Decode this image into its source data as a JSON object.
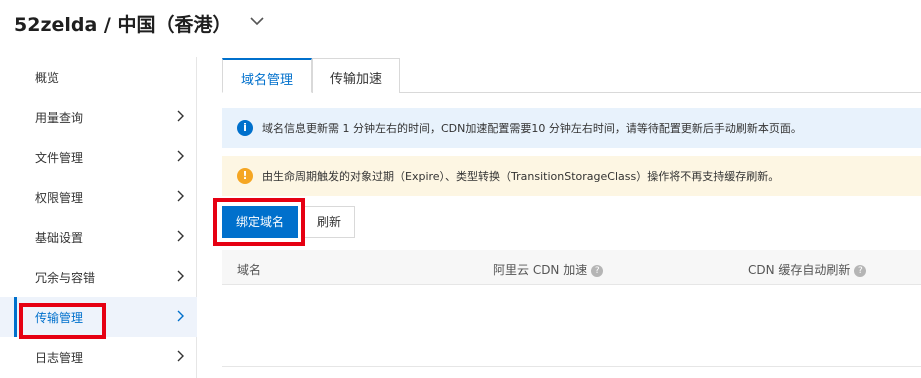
{
  "header": {
    "title": "52zelda / 中国（香港）",
    "dropdown_icon": "chevron-down-icon"
  },
  "sidebar": {
    "items": [
      {
        "label": "概览",
        "has_arrow": false
      },
      {
        "label": "用量查询",
        "has_arrow": true
      },
      {
        "label": "文件管理",
        "has_arrow": true
      },
      {
        "label": "权限管理",
        "has_arrow": true
      },
      {
        "label": "基础设置",
        "has_arrow": true
      },
      {
        "label": "冗余与容错",
        "has_arrow": true
      },
      {
        "label": "传输管理",
        "has_arrow": true,
        "active": true
      },
      {
        "label": "日志管理",
        "has_arrow": true
      }
    ]
  },
  "tabs": [
    {
      "label": "域名管理",
      "active": true
    },
    {
      "label": "传输加速",
      "active": false
    }
  ],
  "alerts": {
    "info": "域名信息更新需 1 分钟左右的时间，CDN加速配置需要10 分钟左右时间，请等待配置更新后手动刷新本页面。",
    "warning": "由生命周期触发的对象过期（Expire）、类型转换（TransitionStorageClass）操作将不再支持缓存刷新。"
  },
  "toolbar": {
    "bind_domain_label": "绑定域名",
    "refresh_label": "刷新"
  },
  "table": {
    "columns": [
      "域名",
      "阿里云 CDN 加速",
      "CDN 缓存自动刷新"
    ]
  },
  "colors": {
    "accent": "#0070cc",
    "highlight_box": "#e60012",
    "info_bg": "#e8f2fc",
    "warning_bg": "#fdf6e3",
    "warning_icon": "#f5a623"
  }
}
